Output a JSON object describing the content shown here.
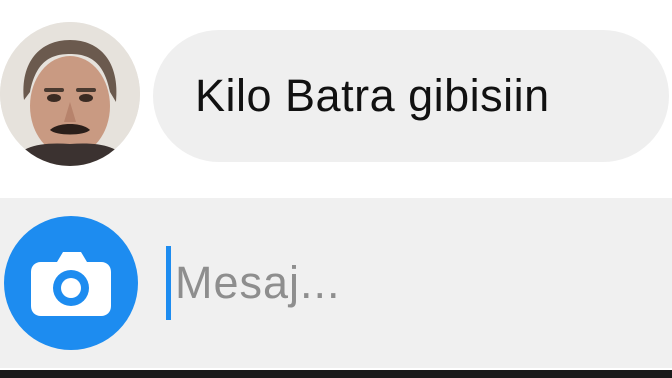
{
  "conversation": {
    "message": {
      "text": "Kilo Batra gibisiin",
      "avatar_icon": "user-avatar"
    }
  },
  "composer": {
    "camera_icon": "camera-icon",
    "input_placeholder": "Mesaj...",
    "accent_color": "#1d8cf0"
  }
}
